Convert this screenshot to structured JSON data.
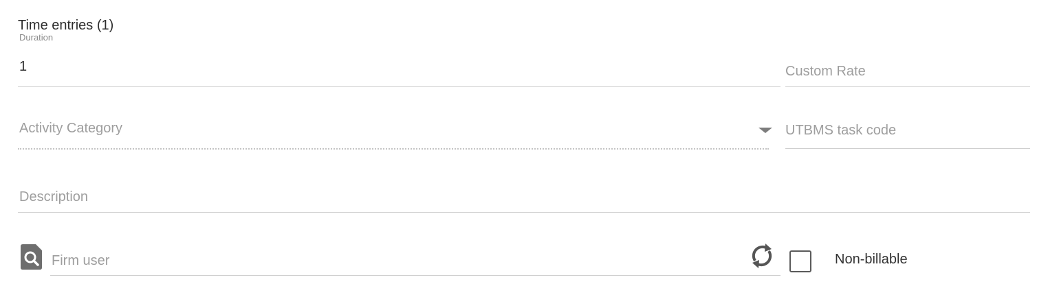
{
  "section": {
    "title": "Time entries (1)"
  },
  "duration": {
    "label": "Duration",
    "value": "1"
  },
  "custom_rate": {
    "placeholder": "Custom Rate"
  },
  "activity_category": {
    "placeholder": "Activity Category"
  },
  "utbms": {
    "placeholder": "UTBMS task code"
  },
  "description": {
    "placeholder": "Description"
  },
  "firm_user": {
    "placeholder": "Firm user"
  },
  "non_billable": {
    "label": "Non-billable",
    "checked": false
  },
  "icons": {
    "search": "search-user-icon",
    "refresh": "refresh-icon",
    "dropdown": "caret-down-icon"
  }
}
